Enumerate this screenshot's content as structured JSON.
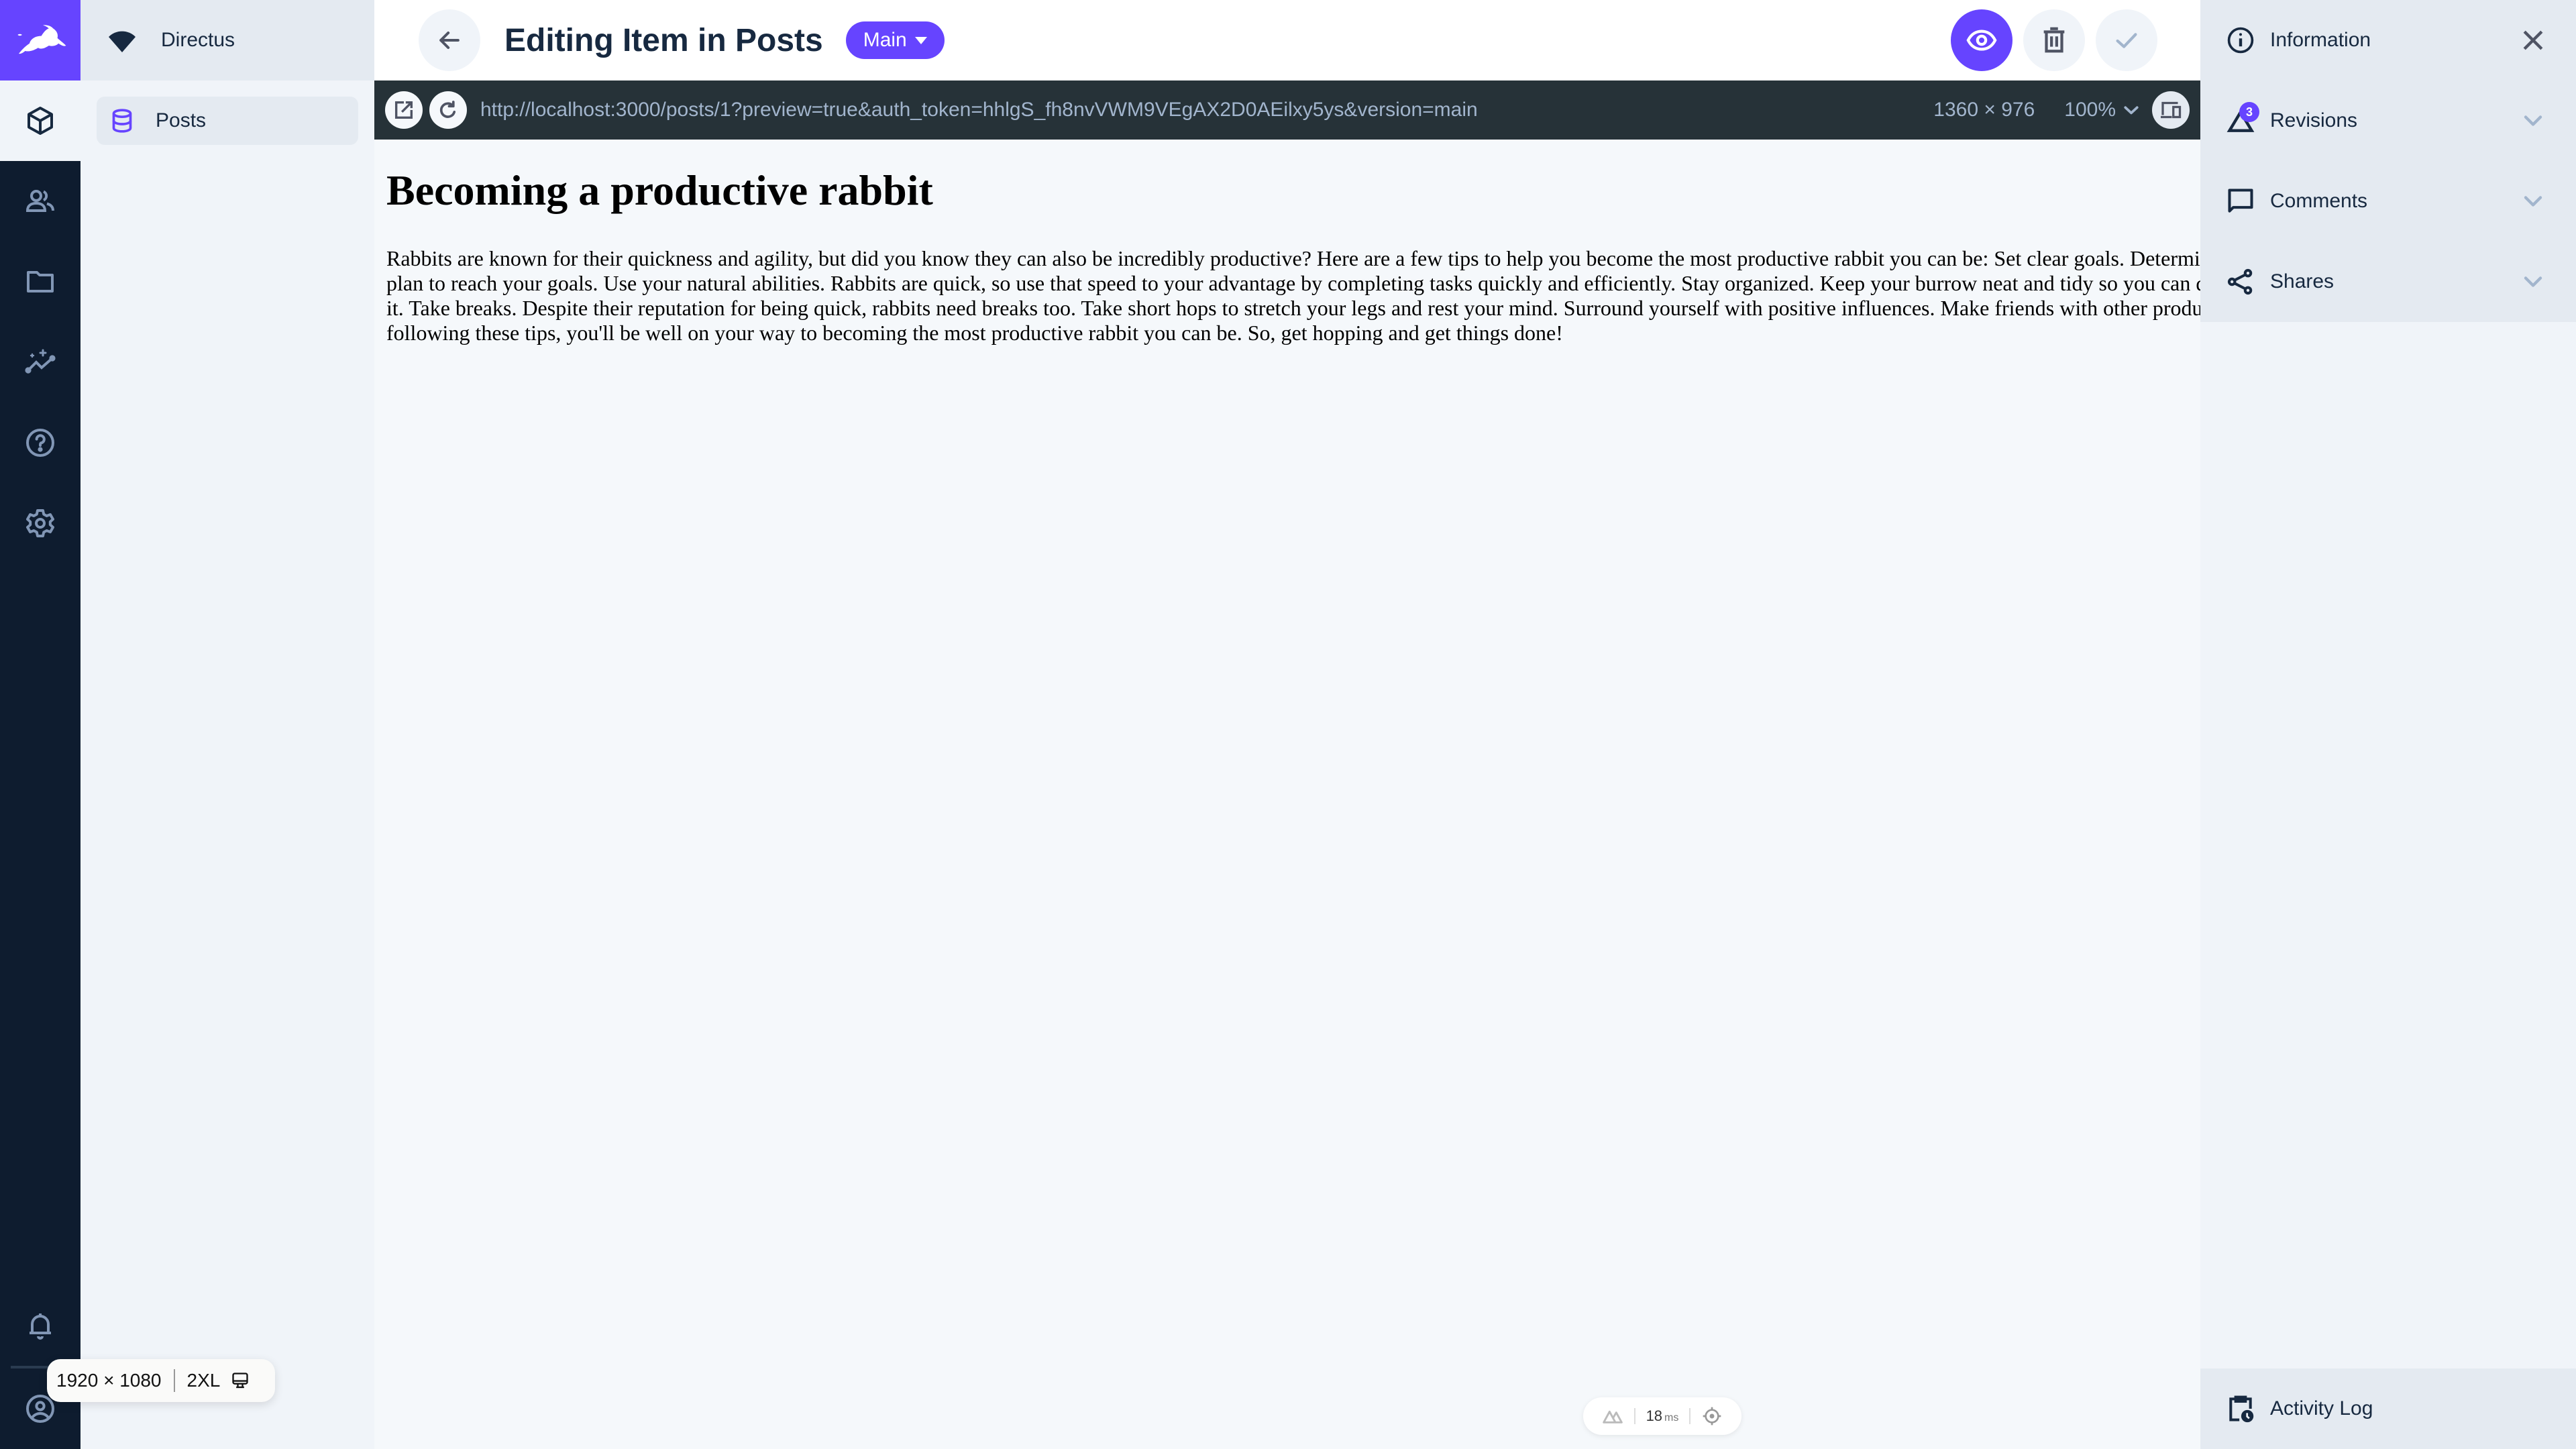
{
  "app": {
    "project_name": "Directus",
    "brand_color": "#6644ff"
  },
  "module_bar": {
    "items": [
      {
        "name": "content",
        "icon": "cube-icon",
        "active": true
      },
      {
        "name": "user-directory",
        "icon": "users-icon"
      },
      {
        "name": "files",
        "icon": "folder-icon"
      },
      {
        "name": "insights",
        "icon": "insights-icon"
      },
      {
        "name": "help",
        "icon": "help-icon"
      },
      {
        "name": "settings",
        "icon": "gear-icon"
      }
    ],
    "bottom": [
      {
        "name": "notifications",
        "icon": "bell-icon"
      },
      {
        "name": "user",
        "icon": "user-avatar-icon"
      }
    ]
  },
  "nav": {
    "collections": [
      {
        "label": "Posts",
        "icon": "database-icon",
        "active": true
      }
    ]
  },
  "header": {
    "title": "Editing Item in Posts",
    "version": "Main",
    "actions": [
      {
        "name": "preview",
        "icon": "eye-icon",
        "active": true
      },
      {
        "name": "delete",
        "icon": "trash-icon"
      },
      {
        "name": "save",
        "icon": "check-icon",
        "disabled": true
      }
    ]
  },
  "preview_bar": {
    "url": "http://localhost:3000/posts/1?preview=true&auth_token=hhlgS_fh8nvVWM9VEgAX2D0AEilxy5ys&version=main",
    "dimensions": "1360 × 976",
    "zoom": "100%"
  },
  "preview_content": {
    "heading": "Becoming a productive rabbit",
    "body": "Rabbits are known for their quickness and agility, but did you know they can also be incredibly productive? Here are a few tips to help you become the most productive rabbit you can be: Set clear goals. Determine what you want to achieve and make a plan to reach your goals. Use your natural abilities. Rabbits are quick, so use that speed to your advantage by completing tasks quickly and efficiently. Stay organized. Keep your burrow neat and tidy so you can quickly find what you need when you need it. Take breaks. Despite their reputation for being quick, rabbits need breaks too. Take short hops to stretch your legs and rest your mind. Surround yourself with positive influences. Make friends with other productive rabbits and learn from their habits. By following these tips, you'll be well on your way to becoming the most productive rabbit you can be. So, get hopping and get things done!"
  },
  "dev_overlay": {
    "render_time": "18",
    "render_unit": "ms",
    "viewport": "1920 × 1080",
    "breakpoint": "2XL"
  },
  "sidebar": {
    "items": [
      {
        "label": "Information",
        "icon": "info-icon",
        "trail": "close"
      },
      {
        "label": "Revisions",
        "icon": "revisions-icon",
        "badge": "3",
        "trail": "chevron"
      },
      {
        "label": "Comments",
        "icon": "comment-icon",
        "trail": "chevron"
      },
      {
        "label": "Shares",
        "icon": "share-icon",
        "trail": "chevron"
      }
    ],
    "footer": {
      "label": "Activity Log",
      "icon": "activity-log-icon"
    }
  }
}
